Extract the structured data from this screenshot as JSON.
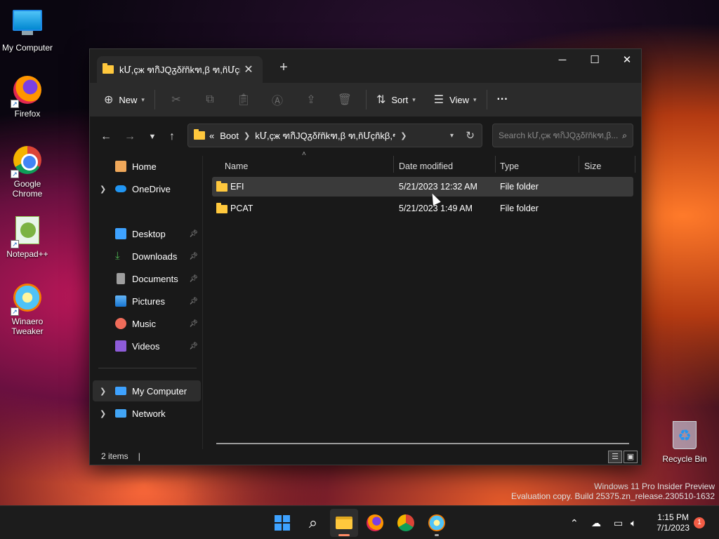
{
  "desktop": {
    "icons": [
      {
        "label": "My Computer",
        "icon": "monitor-icon"
      },
      {
        "label": "Firefox",
        "icon": "firefox-icon"
      },
      {
        "label": "Google Chrome",
        "icon": "chrome-icon"
      },
      {
        "label": "Notepad++",
        "icon": "notepadpp-icon"
      },
      {
        "label": "Winaero Tweaker",
        "icon": "winaero-icon"
      },
      {
        "label": "Recycle Bin",
        "icon": "recycle-bin-icon"
      }
    ],
    "watermark_line1": "Windows 11 Pro Insider Preview",
    "watermark_line2": "Evaluation copy. Build 25375.zn_release.230510-1632"
  },
  "explorer": {
    "tab_title": "kՄ,çж ฑกิJQᵹδřñkฑ,β ฑ,ñՄçñk",
    "new_tab": "+",
    "window_controls": {
      "minimize": "─",
      "maximize": "☐",
      "close": "✕"
    },
    "toolbar": {
      "new_label": "New",
      "sort_label": "Sort",
      "view_label": "View",
      "more_label": "···"
    },
    "address": {
      "overflow": "«",
      "crumbs": [
        "Boot",
        "kՄ,çж ฑกิJQᵹδřñkฑ,β ฑ,ñՄçñkβ,ฑç,..."
      ]
    },
    "search_placeholder": "Search kՄ,çж ฑกิJQᵹδřñkฑ,β...",
    "nav": {
      "home": "Home",
      "onedrive": "OneDrive",
      "quick_access": [
        "Desktop",
        "Downloads",
        "Documents",
        "Pictures",
        "Music",
        "Videos"
      ],
      "my_computer": "My Computer",
      "network": "Network"
    },
    "columns": {
      "name": "Name",
      "date": "Date modified",
      "type": "Type",
      "size": "Size"
    },
    "rows": [
      {
        "name": "EFI",
        "date": "5/21/2023 12:32 AM",
        "type": "File folder",
        "size": ""
      },
      {
        "name": "PCAT",
        "date": "5/21/2023 1:49 AM",
        "type": "File folder",
        "size": ""
      }
    ],
    "status": {
      "items": "2 items",
      "separator": "|"
    }
  },
  "taskbar": {
    "time": "1:15 PM",
    "date": "7/1/2023",
    "notifications": "1"
  },
  "colors": {
    "accent": "#3ea2ff",
    "folder": "#ffc83d",
    "window_bg": "#191919",
    "toolbar_bg": "#2b2b2b"
  }
}
